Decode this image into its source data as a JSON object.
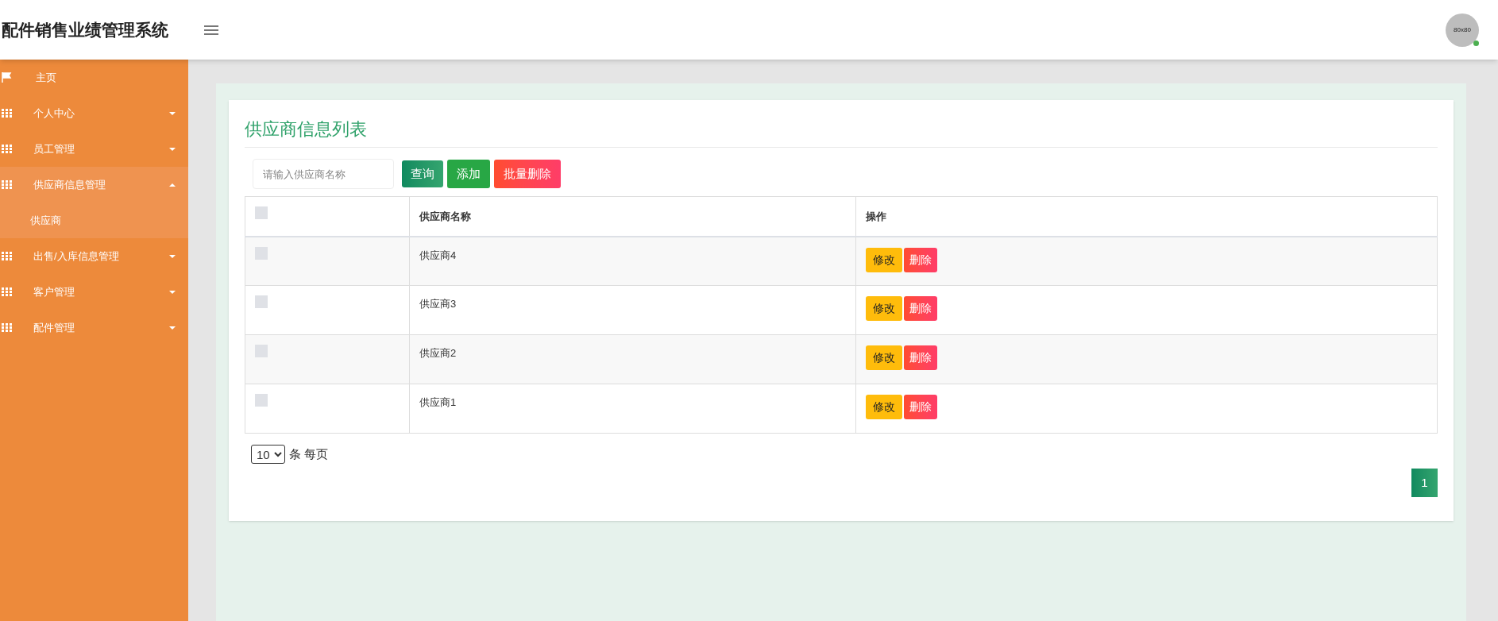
{
  "header": {
    "title": "配件销售业绩管理系统",
    "avatar_text": "80x80",
    "online": true
  },
  "sidebar": {
    "items": [
      {
        "label": "主页",
        "kind": "home",
        "expanded": false
      },
      {
        "label": "个人中心",
        "kind": "menu",
        "expanded": false
      },
      {
        "label": "员工管理",
        "kind": "menu",
        "expanded": false
      },
      {
        "label": "供应商信息管理",
        "kind": "menu",
        "expanded": true,
        "children": [
          {
            "label": "供应商"
          }
        ]
      },
      {
        "label": "出售/入库信息管理",
        "kind": "menu",
        "expanded": false
      },
      {
        "label": "客户管理",
        "kind": "menu",
        "expanded": false
      },
      {
        "label": "配件管理",
        "kind": "menu",
        "expanded": false
      }
    ]
  },
  "page": {
    "title": "供应商信息列表",
    "search": {
      "placeholder": "请输入供应商名称"
    },
    "toolbar_buttons": [
      {
        "label": "查询",
        "kind": "query"
      },
      {
        "label": "添加",
        "kind": "add"
      },
      {
        "label": "批量删除",
        "kind": "batch_delete"
      }
    ],
    "table": {
      "select_all_checked": false,
      "columns": [
        "供应商名称",
        "操作"
      ],
      "rows": [
        {
          "checked": false,
          "name": "供应商4",
          "actions": [
            "修改",
            "删除"
          ]
        },
        {
          "checked": false,
          "name": "供应商3",
          "actions": [
            "修改",
            "删除"
          ]
        },
        {
          "checked": false,
          "name": "供应商2",
          "actions": [
            "修改",
            "删除"
          ]
        },
        {
          "checked": false,
          "name": "供应商1",
          "actions": [
            "修改",
            "删除"
          ]
        }
      ]
    },
    "page_size": {
      "value": "10",
      "label": "条 每页"
    },
    "pagination": [
      {
        "label": "1",
        "selected": true
      }
    ]
  }
}
